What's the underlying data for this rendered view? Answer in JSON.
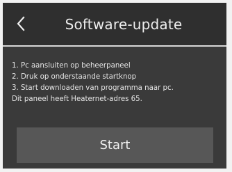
{
  "header": {
    "back_icon": "chevron-left-icon",
    "title": "Software-update"
  },
  "instructions": [
    "1. Pc aansluiten op beheerpaneel",
    "2. Druk op onderstaande startknop",
    "3. Start downloaden van programma naar pc.",
    "Dit paneel heeft Heaternet-adres 65."
  ],
  "actions": {
    "start_label": "Start"
  },
  "colors": {
    "panel_background": "#3a3a3a",
    "header_background": "#2f2f2f",
    "header_divider": "#d8d8d8",
    "button_background": "#575757",
    "text": "#ededed"
  }
}
